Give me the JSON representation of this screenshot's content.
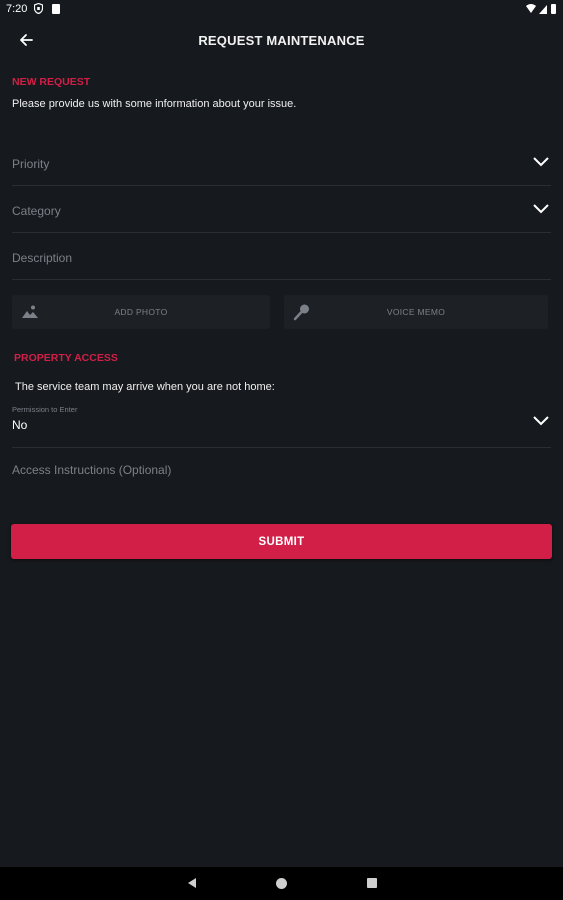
{
  "status_bar": {
    "time": "7:20",
    "icons": [
      "shield-icon",
      "sd-card-icon",
      "wifi-icon",
      "signal-icon",
      "battery-icon"
    ]
  },
  "app_bar": {
    "back_icon": "arrow-left-icon",
    "title": "REQUEST MAINTENANCE"
  },
  "new_request": {
    "section_label": "NEW REQUEST",
    "intro": "Please provide us with some information about your issue.",
    "priority_placeholder": "Priority",
    "category_placeholder": "Category",
    "description_placeholder": "Description",
    "add_photo_label": "ADD PHOTO",
    "voice_memo_label": "VOICE MEMO"
  },
  "property_access": {
    "section_label": "PROPERTY ACCESS",
    "intro": "The service team may arrive when you are not home:",
    "permission_label": "Permission to Enter",
    "permission_value": "No",
    "instructions_placeholder": "Access Instructions (Optional)"
  },
  "submit_label": "SUBMIT",
  "colors": {
    "background": "#16191d",
    "accent": "#d11f48",
    "muted_text": "#7c8189",
    "field_divider": "#2a2e33",
    "media_button_bg": "#1d2126"
  },
  "nav_bar": {
    "icons": [
      "nav-back-icon",
      "nav-home-icon",
      "nav-recents-icon"
    ]
  }
}
